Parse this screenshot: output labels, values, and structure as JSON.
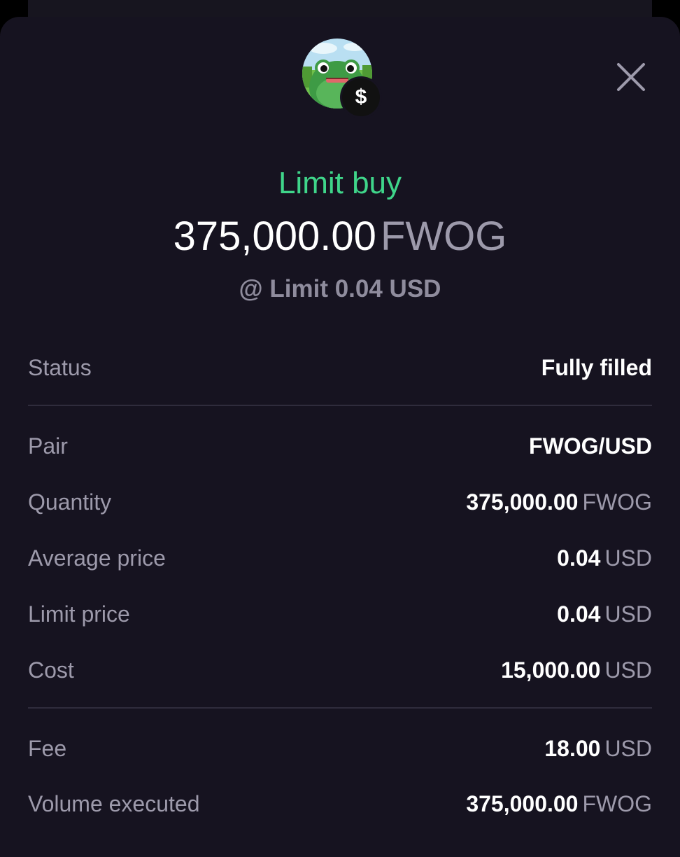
{
  "header": {
    "asset_icon": "fwog-frog-avatar",
    "badge_symbol": "$",
    "close_icon": "close-icon"
  },
  "summary": {
    "order_type": "Limit buy",
    "amount": "375,000.00",
    "amount_unit": "FWOG",
    "limit_text": "@ Limit 0.04 USD"
  },
  "details": {
    "status": {
      "label": "Status",
      "value": "Fully filled"
    },
    "pair": {
      "label": "Pair",
      "value": "FWOG/USD"
    },
    "quantity": {
      "label": "Quantity",
      "value": "375,000.00",
      "unit": "FWOG"
    },
    "average_price": {
      "label": "Average price",
      "value": "0.04",
      "unit": "USD"
    },
    "limit_price": {
      "label": "Limit price",
      "value": "0.04",
      "unit": "USD"
    },
    "cost": {
      "label": "Cost",
      "value": "15,000.00",
      "unit": "USD"
    },
    "fee": {
      "label": "Fee",
      "value": "18.00",
      "unit": "USD"
    },
    "volume_executed": {
      "label": "Volume executed",
      "value": "375,000.00",
      "unit": "FWOG"
    }
  },
  "colors": {
    "background": "#161320",
    "accent_green": "#3fd58a",
    "muted_text": "#9d9aab",
    "divider": "#2f2c3c"
  }
}
